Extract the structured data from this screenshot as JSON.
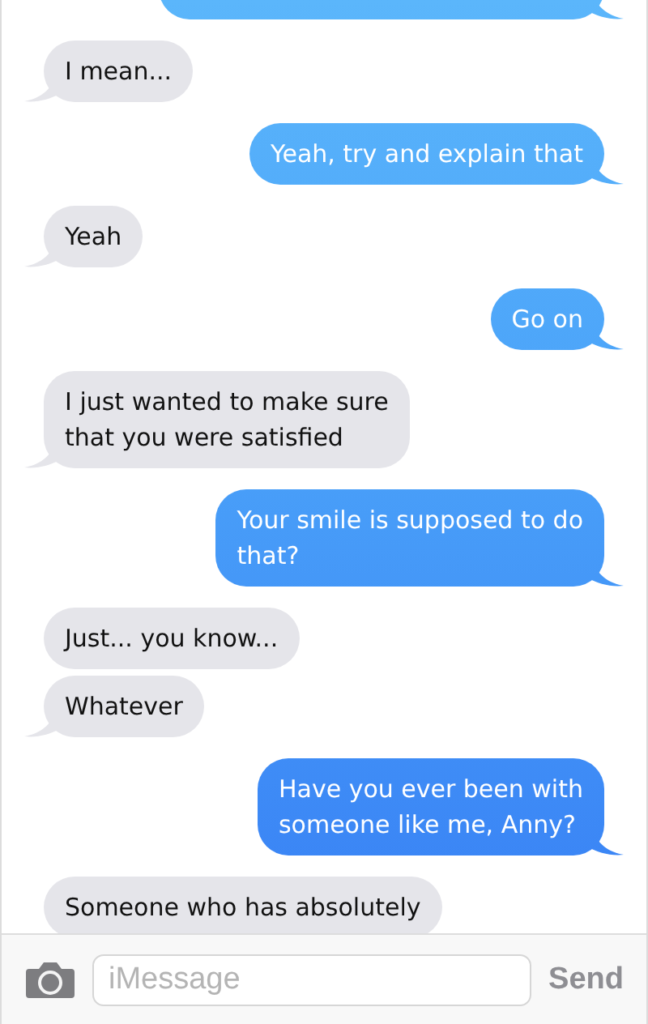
{
  "messages": [
    {
      "kind": "sent",
      "tail": true
    },
    {
      "kind": "received",
      "text": "I mean...",
      "tail": true
    },
    {
      "kind": "sent",
      "text": "Yeah, try and explain that",
      "tail": true
    },
    {
      "kind": "received",
      "text": "Yeah",
      "tail": true
    },
    {
      "kind": "sent",
      "text": "Go on",
      "tail": true
    },
    {
      "kind": "received",
      "text": "I just wanted to make sure\nthat you were satisfied",
      "tail": true
    },
    {
      "kind": "sent",
      "text": "Your smile is supposed to do\nthat?",
      "tail": true
    },
    {
      "kind": "received",
      "text": "Just... you know...",
      "tail": false
    },
    {
      "kind": "received",
      "text": "Whatever",
      "tail": true
    },
    {
      "kind": "sent",
      "text": "Have you ever been with\nsomeone like me, Anny?",
      "tail": true
    },
    {
      "kind": "received",
      "text": "Someone who has absolutely",
      "tail": false
    }
  ],
  "composer": {
    "placeholder": "iMessage",
    "send": "Send"
  }
}
